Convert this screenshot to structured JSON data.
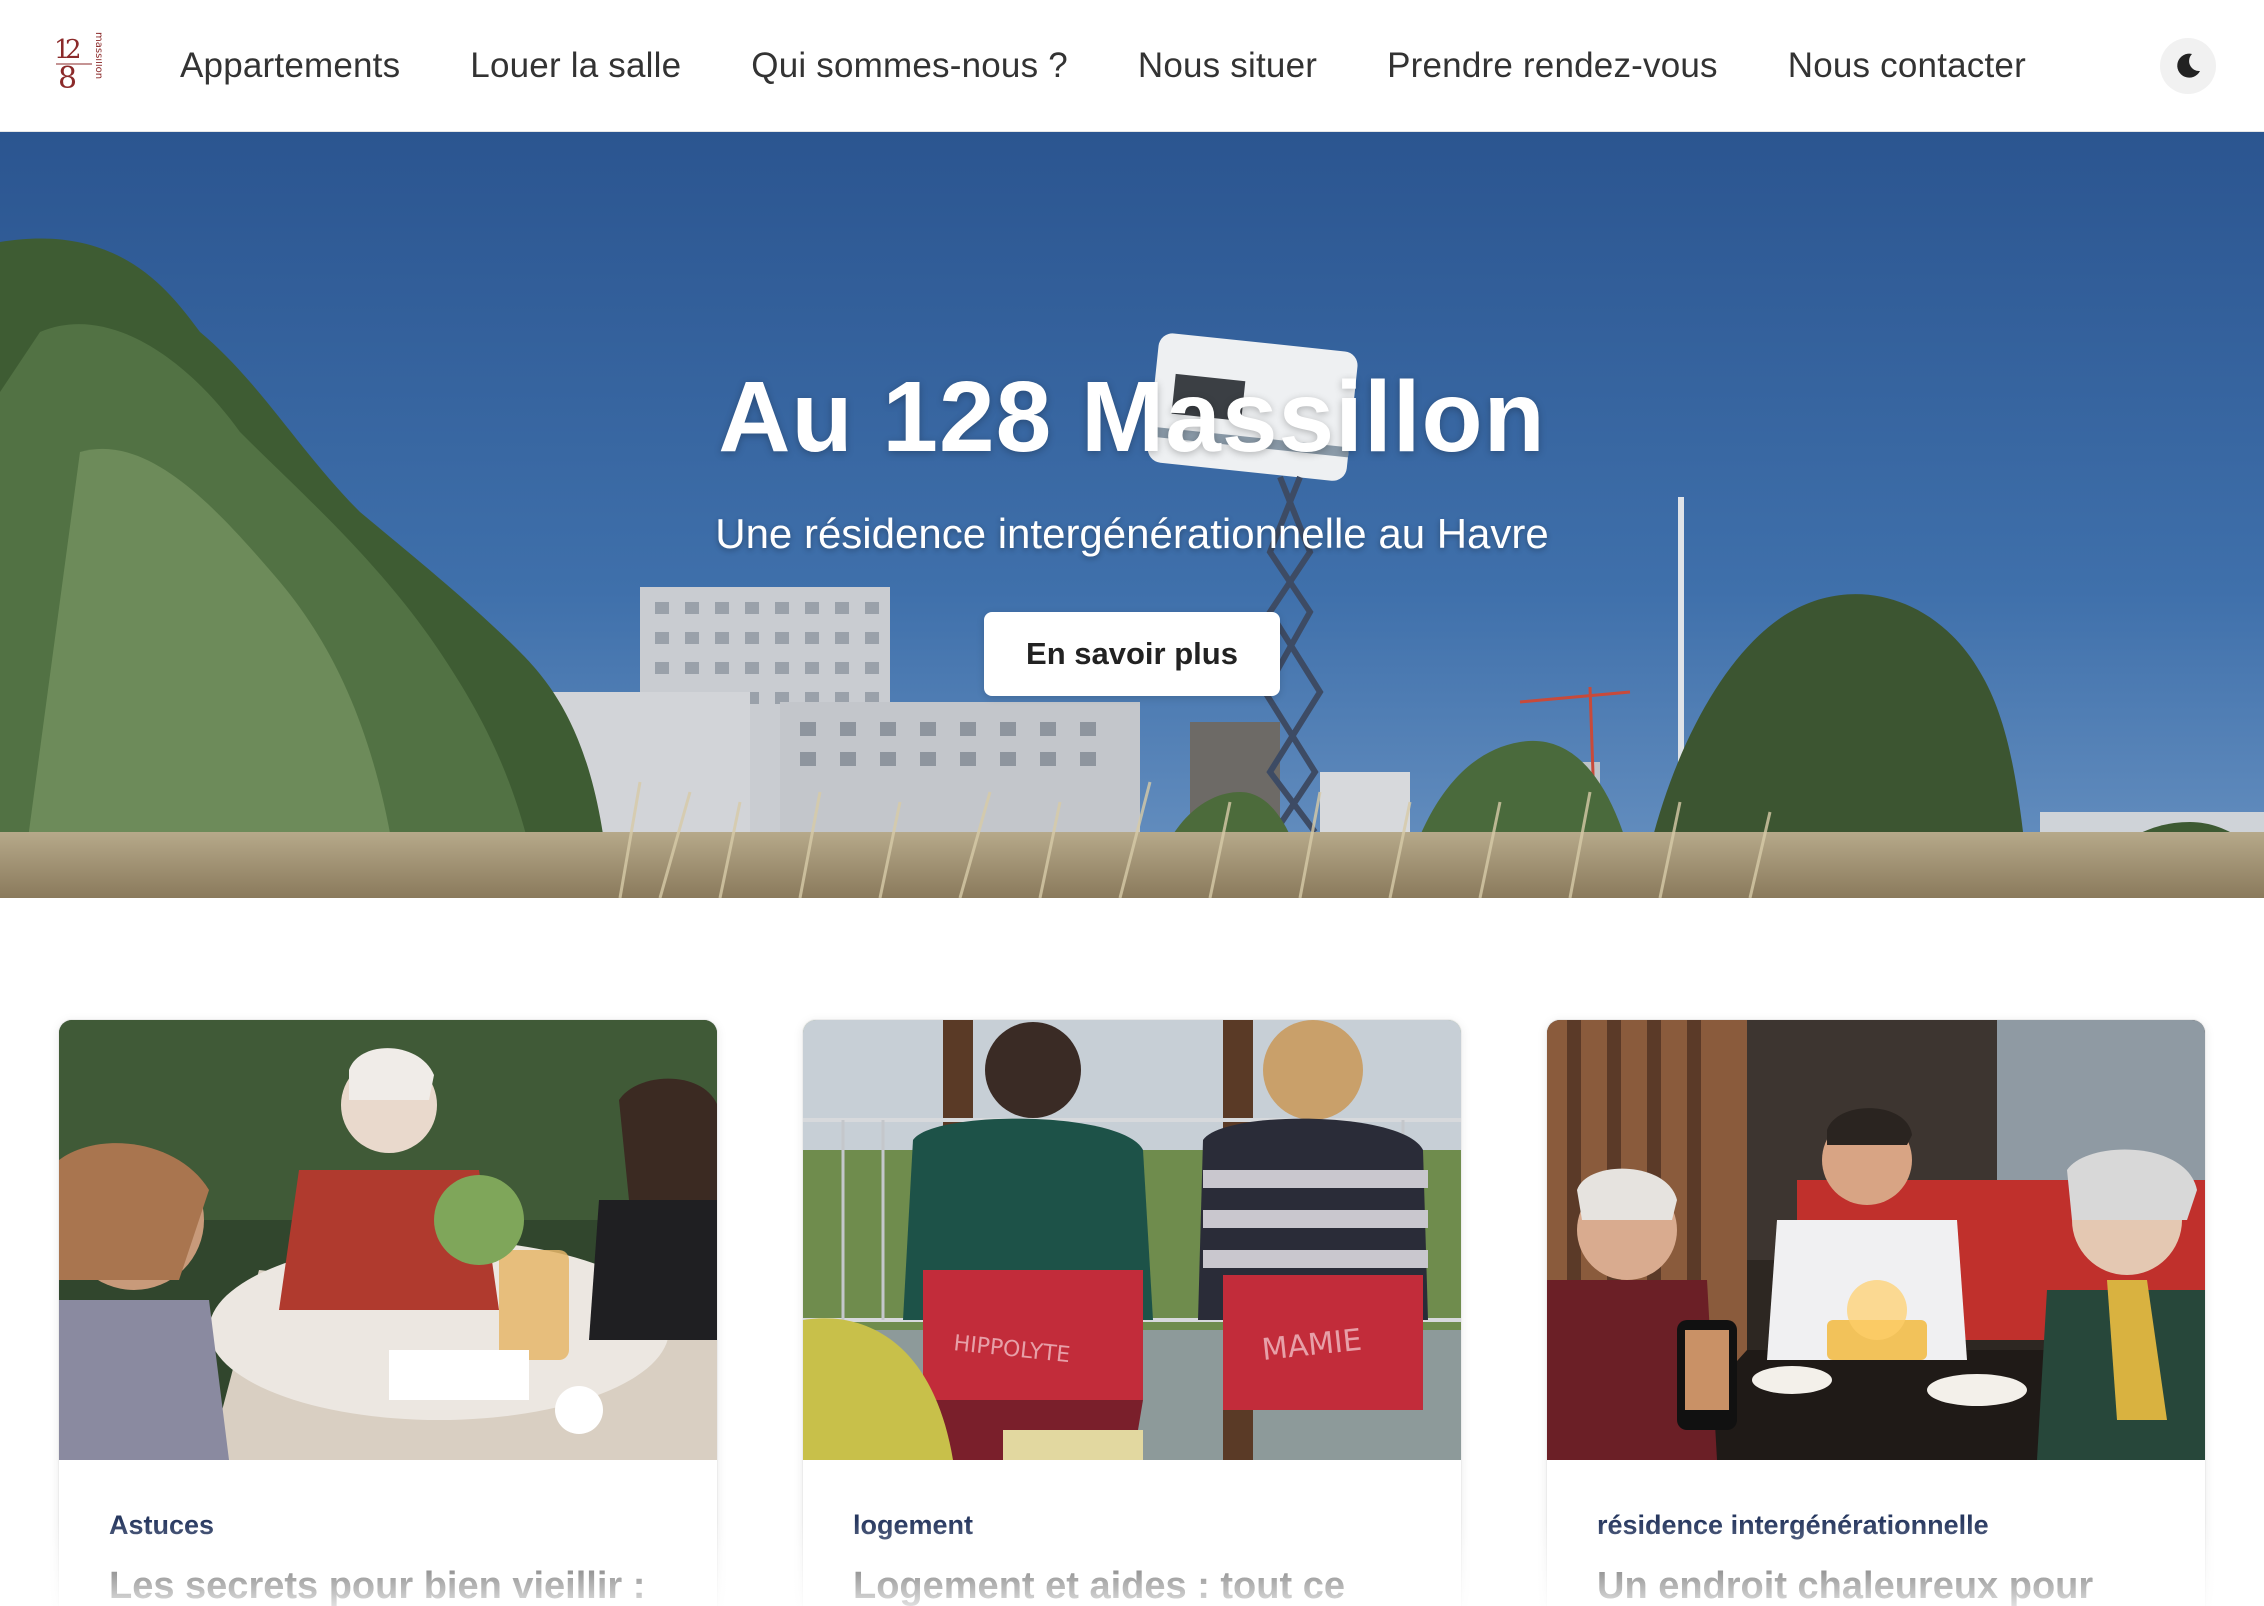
{
  "header": {
    "logo_text": "128 massillon",
    "nav": [
      {
        "label": "Appartements"
      },
      {
        "label": "Louer la salle"
      },
      {
        "label": "Qui sommes-nous ?"
      },
      {
        "label": "Nous situer"
      },
      {
        "label": "Prendre rendez-vous"
      },
      {
        "label": "Nous contacter"
      }
    ],
    "theme_toggle_icon": "moon-icon"
  },
  "hero": {
    "title": "Au 128 Massillon",
    "subtitle": "Une résidence intergénérationnelle au Havre",
    "button_label": "En savoir plus"
  },
  "cards": [
    {
      "tag": "Astuces",
      "title": "Les secrets pour bien vieillir :"
    },
    {
      "tag": "logement",
      "title": "Logement et aides : tout ce"
    },
    {
      "tag": "résidence intergénérationnelle",
      "title": "Un endroit chaleureux pour"
    }
  ],
  "colors": {
    "tag": "#27385f",
    "sky": "#2f5b95",
    "logo": "#8b2a2a"
  }
}
